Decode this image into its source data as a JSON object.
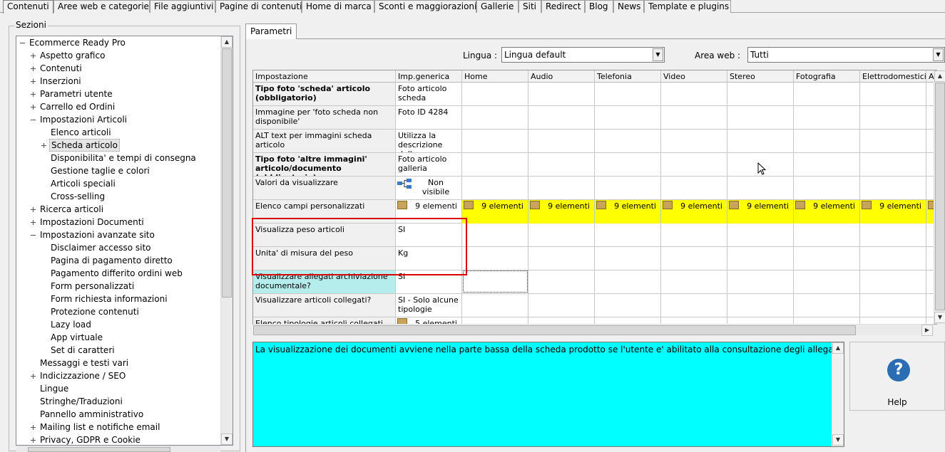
{
  "top_tabs": [
    {
      "label": "Contenuti",
      "active": true
    },
    {
      "label": "Aree web e categorie"
    },
    {
      "label": "File aggiuntivi"
    },
    {
      "label": "Pagine di contenuti"
    },
    {
      "label": "Home di marca"
    },
    {
      "label": "Sconti e maggiorazioni"
    },
    {
      "label": "Gallerie"
    },
    {
      "label": "Siti"
    },
    {
      "label": "Redirect"
    },
    {
      "label": "Blog"
    },
    {
      "label": "News"
    },
    {
      "label": "Template e plugins"
    }
  ],
  "sections": {
    "title": "Sezioni",
    "tree": [
      {
        "label": "Ecommerce Ready Pro",
        "expander": "minus"
      },
      {
        "label": "Aspetto grafico",
        "expander": "plus"
      },
      {
        "label": "Contenuti",
        "expander": "plus"
      },
      {
        "label": "Inserzioni",
        "expander": "plus"
      },
      {
        "label": "Parametri utente",
        "expander": "plus"
      },
      {
        "label": "Carrello ed Ordini",
        "expander": "plus"
      },
      {
        "label": "Impostazioni Articoli",
        "expander": "minus"
      },
      {
        "label": "Elenco articoli"
      },
      {
        "label": "Scheda articolo",
        "expander": "plus",
        "selected": true
      },
      {
        "label": "Disponibilita' e tempi di consegna"
      },
      {
        "label": "Gestione taglie e colori"
      },
      {
        "label": "Articoli speciali"
      },
      {
        "label": "Cross-selling"
      },
      {
        "label": "Ricerca articoli",
        "expander": "plus"
      },
      {
        "label": "Impostazioni Documenti",
        "expander": "plus"
      },
      {
        "label": "Impostazioni avanzate sito",
        "expander": "minus"
      },
      {
        "label": "Disclaimer accesso sito"
      },
      {
        "label": "Pagina di pagamento diretto"
      },
      {
        "label": "Pagamento differito ordini web"
      },
      {
        "label": "Form personalizzati"
      },
      {
        "label": "Form richiesta informazioni"
      },
      {
        "label": "Protezione contenuti"
      },
      {
        "label": "Lazy load"
      },
      {
        "label": "App virtuale"
      },
      {
        "label": "Set di caratteri"
      },
      {
        "label": "Messaggi e testi vari"
      },
      {
        "label": "Indicizzazione / SEO",
        "expander": "plus"
      },
      {
        "label": "Lingue"
      },
      {
        "label": "Stringhe/Traduzioni"
      },
      {
        "label": "Pannello amministrativo"
      },
      {
        "label": "Mailing list e notifiche email",
        "expander": "plus"
      },
      {
        "label": "Privacy, GDPR e Cookie",
        "expander": "plus"
      }
    ]
  },
  "params_tab": "Parametri",
  "filters": {
    "lingua_label": "Lingua :",
    "lingua_value": "Lingua default",
    "area_label": "Area web :",
    "area_value": "Tutti"
  },
  "grid": {
    "columns": [
      "Impostazione",
      "Imp.generica",
      "Home",
      "Audio",
      "Telefonia",
      "Video",
      "Stereo",
      "Fotografia",
      "Elettrodomestici",
      "A"
    ],
    "rows": [
      {
        "name": "Tipo foto 'scheda' articolo (obbligatorio)",
        "bold": true,
        "value": "Foto articolo scheda"
      },
      {
        "name": "Immagine per 'foto scheda non disponibile'",
        "value": "Foto ID 4284"
      },
      {
        "name": "ALT text per immagini scheda articolo",
        "value": "Utilizza la descrizione dell..."
      },
      {
        "name": "Tipo foto 'altre immagini' articolo/documento (obbligatorio)",
        "bold": true,
        "value": "Foto articolo galleria"
      },
      {
        "name": "Valori da visualizzare",
        "value": "Non visibile",
        "icon": "hierarchy-icon"
      },
      {
        "name": "Elenco campi personalizzati",
        "value": "9 elementi",
        "icon": "box-icon",
        "area_value": "9 elementi",
        "highlight": "#ffff00"
      },
      {
        "name": "Visualizza peso articoli",
        "value": "SI"
      },
      {
        "name": "Unita' di misura del peso",
        "value": "Kg"
      },
      {
        "name": "Visualizzare allegati archiviazione documentale?",
        "value": "SI",
        "highlight": "#b5ecec"
      },
      {
        "name": "Visualizzare articoli collegati?",
        "value": "SI - Solo alcune tipologie"
      },
      {
        "name": "Elenco tipologie articoli collegati da",
        "value": "5 elementi",
        "icon": "box-icon"
      }
    ]
  },
  "description": "La visualizzazione dei documenti avviene nella parte bassa della scheda prodotto se l'utente e' abilitato alla consultazione degli allegati",
  "help": {
    "label": "Help",
    "icon": "?"
  },
  "colors": {
    "highlight_red": "#dd0000",
    "cyan": "#00ffff",
    "yellow": "#ffff00"
  }
}
